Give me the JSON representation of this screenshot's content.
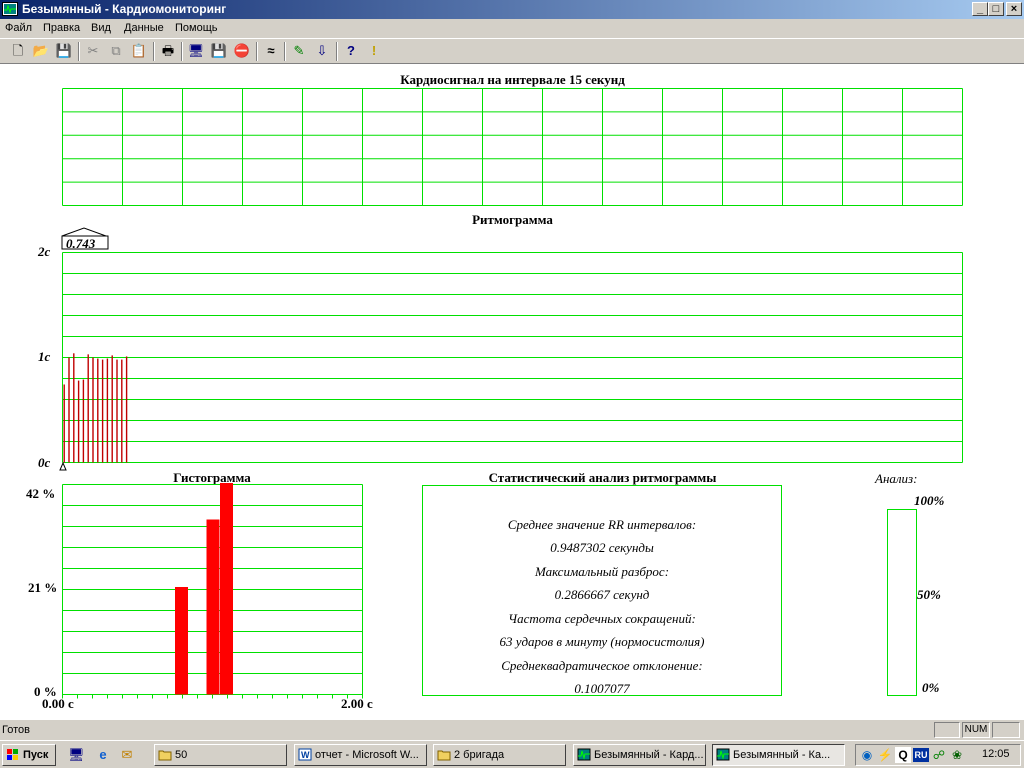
{
  "window": {
    "title": "Безымянный - Кардиомониторинг",
    "minimize_glyph": "_",
    "maximize_glyph": "□",
    "close_glyph": "×"
  },
  "menu": [
    "Файл",
    "Правка",
    "Вид",
    "Данные",
    "Помощь"
  ],
  "toolbar": {
    "icons": [
      "new-file-icon",
      "open-folder-icon",
      "save-icon",
      "cut-icon",
      "copy-icon",
      "paste-icon",
      "print-icon",
      "monitor-icon",
      "save-data-icon",
      "stop-icon",
      "signal-icon",
      "pen-icon",
      "import-icon",
      "help-icon",
      "info-icon"
    ],
    "glyphs": {
      "new": "🗋",
      "open": "📂",
      "save": "💾",
      "cut": "✂",
      "copy": "⧉",
      "paste": "📋",
      "print": "🖶",
      "monitor": "🖥",
      "savedata": "💾",
      "stop": "⛔",
      "signal": "≈",
      "pen": "✎",
      "import": "⇩",
      "help": "?",
      "info": "!"
    }
  },
  "cardio": {
    "title": "Кардиосигнал на интервале 15 секунд",
    "grid_color": "#00e000"
  },
  "rhythmogram": {
    "title": "Ритмограмма",
    "cursor_value": "0.743",
    "y_labels": [
      "2c",
      "1c",
      "0c"
    ],
    "bar_color": "#c00000",
    "chart_data": {
      "type": "bar",
      "ylim": [
        0,
        2
      ],
      "values": [
        0.743,
        1.0,
        1.04,
        0.78,
        0.79,
        1.03,
        1.0,
        0.99,
        0.98,
        0.99,
        1.02,
        0.98,
        0.98,
        1.01
      ]
    }
  },
  "histogram": {
    "title": "Гистограмма",
    "y_labels": [
      "42 %",
      "21 %",
      "0 %"
    ],
    "x_labels": [
      "0.00 c",
      "2.00 c"
    ],
    "bar_color": "#ff0000",
    "chart_data": {
      "type": "bar",
      "xlim": [
        0,
        2
      ],
      "ylim": [
        0,
        42
      ],
      "bars": [
        {
          "x": 0.75,
          "value": 21.5
        },
        {
          "x": 0.96,
          "value": 35
        },
        {
          "x": 1.05,
          "value": 44
        }
      ]
    }
  },
  "stats": {
    "title": "Статистический анализ ритмограммы",
    "lines": [
      "Среднее значение RR интервалов:",
      "0.9487302 секунды",
      "Максимальный разброс:",
      "0.2866667 секунд",
      "Частота сердечных сокращений:",
      "63 ударов в минуту (нормосистолия)",
      "Среднеквадратическое отклонение:",
      "0.1007077"
    ]
  },
  "analysis": {
    "title": "Анализ:",
    "labels": [
      "100%",
      "50%",
      "0%"
    ],
    "level_percent": 0
  },
  "status": {
    "text": "Готов",
    "num": "NUM"
  },
  "taskbar": {
    "start": "Пуск",
    "buttons": [
      "50",
      "отчет - Microsoft W...",
      "2 бригада",
      "Безымянный - Кард...",
      "Безымянный - Ка..."
    ],
    "lang": "RU",
    "clock": "12:05"
  }
}
